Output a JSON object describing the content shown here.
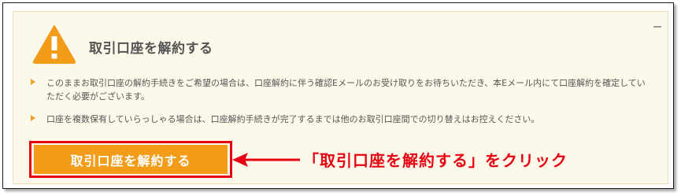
{
  "panel": {
    "title": "取引口座を解約する",
    "notes": [
      "このままお取引口座の解約手続きをご希望の場合は、口座解約に伴う確認Eメールのお受け取りをお待ちいただき、本Eメール内にて口座解約を確定していただく必要がございます。",
      "口座を複数保有していらっしゃる場合は、口座解約手続きが完了するまでは他のお取引口座間での切り替えはお控えください。"
    ],
    "button_label": "取引口座を解約する"
  },
  "annotation": {
    "callout": "「取引口座を解約する」をクリック"
  },
  "icons": {
    "warning": "warning-icon",
    "collapse": "minus-icon",
    "bullet": "triangle-bullet-icon",
    "arrow": "red-arrow-icon"
  },
  "colors": {
    "accent": "#f29c19",
    "highlight": "#e60012",
    "panel_bg": "#fdf9ea",
    "text": "#555555"
  }
}
